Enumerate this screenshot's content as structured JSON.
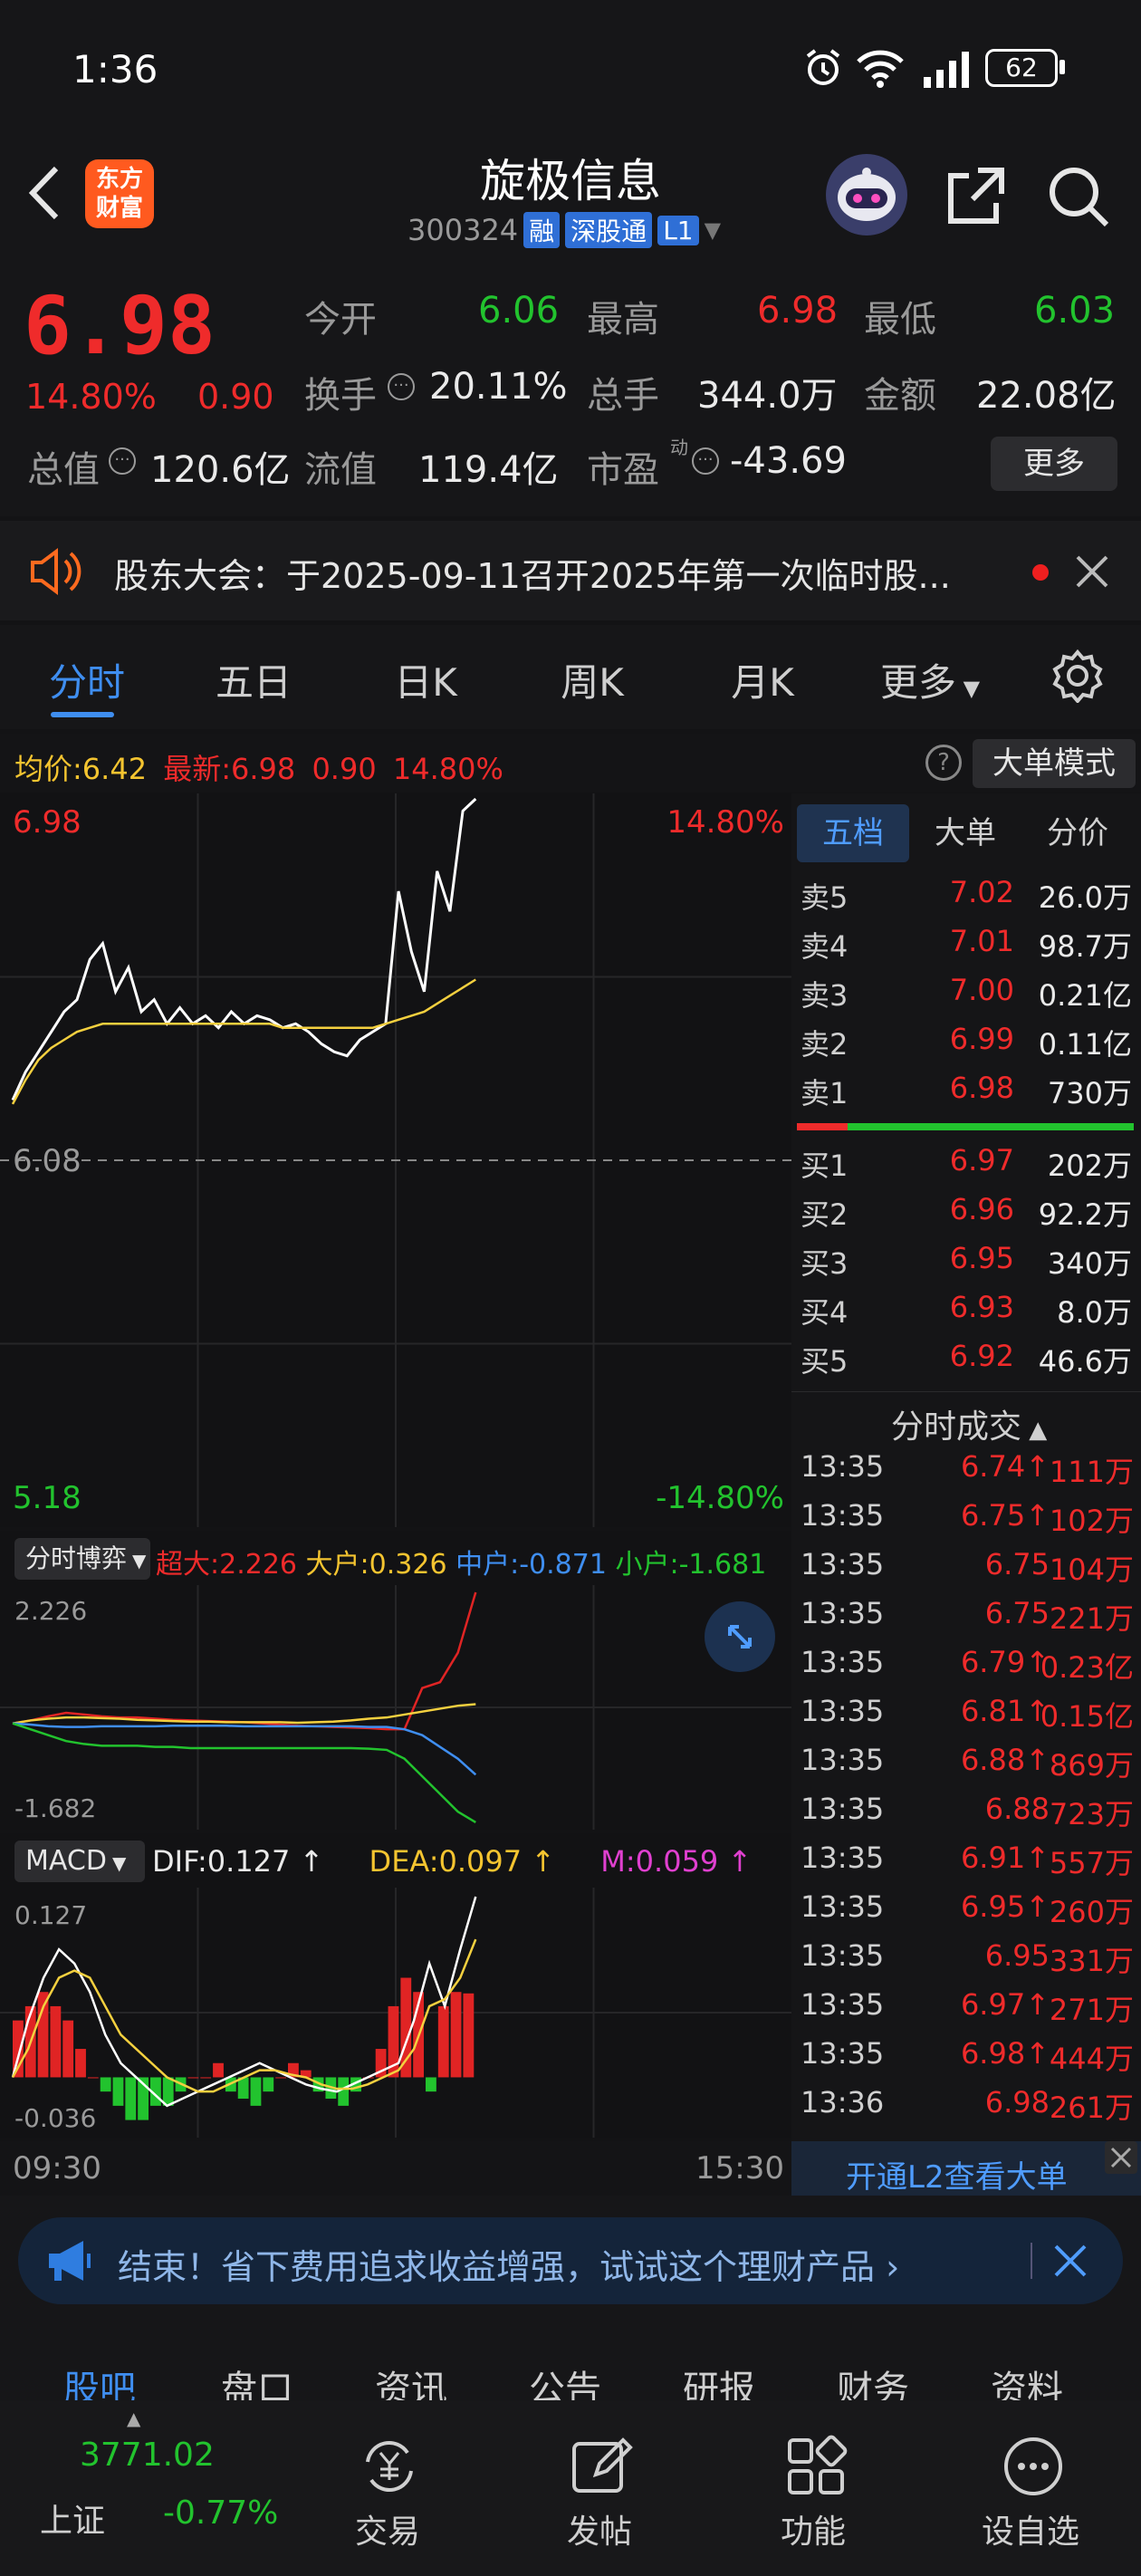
{
  "status": {
    "time": "1:36",
    "battery": "62"
  },
  "header": {
    "name": "旋极信息",
    "code": "300324",
    "tag_rong": "融",
    "tag_sgt": "深股通",
    "tag_l1": "L1",
    "logo_line1": "东方",
    "logo_line2": "财富"
  },
  "quote": {
    "price": "6.98",
    "pct": "14.80%",
    "chg": "0.90",
    "open_label": "今开",
    "open": "6.06",
    "high_label": "最高",
    "high": "6.98",
    "low_label": "最低",
    "low": "6.03",
    "turnover_label": "换手",
    "turnover": "20.11%",
    "vol_label": "总手",
    "vol": "344.0万",
    "amt_label": "金额",
    "amt": "22.08亿",
    "mcap_label": "总值",
    "mcap": "120.6亿",
    "fmcap_label": "流值",
    "fmcap": "119.4亿",
    "pe_label": "市盈",
    "pe_sup": "动",
    "pe": "-43.69",
    "more": "更多"
  },
  "notice": {
    "text": "股东大会：于2025-09-11召开2025年第一次临时股..."
  },
  "tabs": [
    "分时",
    "五日",
    "日K",
    "周K",
    "月K",
    "更多"
  ],
  "infobar": {
    "avg_label": "均价:",
    "avg": "6.42",
    "last_label": "最新:",
    "last": "6.98",
    "chg": "0.90",
    "pct": "14.80%",
    "mode": "大单模式"
  },
  "chart_data": [
    {
      "type": "line",
      "title": "分时",
      "x_range": [
        "09:30",
        "15:30"
      ],
      "y_top": "6.98",
      "y_base": "6.08",
      "y_bottom": "5.18",
      "pct_top": "14.80%",
      "pct_bottom": "-14.80%",
      "series": [
        {
          "name": "价格",
          "color": "#ffffff",
          "values": [
            6.23,
            6.3,
            6.35,
            6.4,
            6.45,
            6.48,
            6.58,
            6.62,
            6.5,
            6.56,
            6.45,
            6.48,
            6.42,
            6.46,
            6.42,
            6.44,
            6.41,
            6.45,
            6.42,
            6.44,
            6.43,
            6.41,
            6.42,
            6.4,
            6.37,
            6.35,
            6.34,
            6.38,
            6.4,
            6.42,
            6.75,
            6.6,
            6.5,
            6.8,
            6.7,
            6.95,
            6.98
          ]
        },
        {
          "name": "均价",
          "color": "#f4d03f",
          "values": [
            6.22,
            6.28,
            6.33,
            6.36,
            6.38,
            6.4,
            6.41,
            6.42,
            6.42,
            6.42,
            6.42,
            6.42,
            6.42,
            6.42,
            6.42,
            6.42,
            6.42,
            6.42,
            6.42,
            6.42,
            6.42,
            6.41,
            6.41,
            6.41,
            6.41,
            6.41,
            6.41,
            6.41,
            6.41,
            6.42,
            6.43,
            6.44,
            6.45,
            6.47,
            6.49,
            6.51,
            6.53
          ]
        }
      ]
    },
    {
      "type": "line",
      "title": "分时博弈",
      "labels": {
        "btn": "分时博弈",
        "super_label": "超大:",
        "super": "2.226",
        "big_label": "大户:",
        "big": "0.326",
        "mid_label": "中户:",
        "mid": "-0.871",
        "small_label": "小户:",
        "small": "-1.681"
      },
      "ylim": [
        "-1.682",
        "2.226"
      ],
      "series": [
        {
          "name": "超大",
          "color": "#e02424",
          "values": [
            0.0,
            0.05,
            0.12,
            0.18,
            0.15,
            0.12,
            0.1,
            0.1,
            0.08,
            0.06,
            0.05,
            0.04,
            0.03,
            0.02,
            0.0,
            -0.02,
            -0.04,
            -0.05,
            -0.06,
            -0.07,
            -0.08,
            -0.1,
            -0.1,
            0.6,
            0.7,
            1.2,
            2.226
          ]
        },
        {
          "name": "大户",
          "color": "#f4d03f",
          "values": [
            0.0,
            0.05,
            0.08,
            0.1,
            0.1,
            0.09,
            0.08,
            0.06,
            0.05,
            0.04,
            0.03,
            0.03,
            0.02,
            0.02,
            0.02,
            0.02,
            0.01,
            0.02,
            0.03,
            0.05,
            0.08,
            0.1,
            0.15,
            0.2,
            0.25,
            0.3,
            0.326
          ]
        },
        {
          "name": "中户",
          "color": "#3f8ef0",
          "values": [
            0.0,
            -0.02,
            -0.05,
            -0.06,
            -0.06,
            -0.05,
            -0.05,
            -0.05,
            -0.05,
            -0.04,
            -0.04,
            -0.04,
            -0.04,
            -0.05,
            -0.05,
            -0.05,
            -0.05,
            -0.05,
            -0.05,
            -0.05,
            -0.06,
            -0.06,
            -0.1,
            -0.2,
            -0.4,
            -0.6,
            -0.871
          ]
        },
        {
          "name": "小户",
          "color": "#22c32e",
          "values": [
            0.0,
            -0.1,
            -0.2,
            -0.3,
            -0.35,
            -0.38,
            -0.38,
            -0.38,
            -0.4,
            -0.4,
            -0.42,
            -0.42,
            -0.42,
            -0.42,
            -0.42,
            -0.42,
            -0.42,
            -0.42,
            -0.42,
            -0.42,
            -0.43,
            -0.45,
            -0.6,
            -0.9,
            -1.2,
            -1.5,
            -1.681
          ]
        }
      ]
    },
    {
      "type": "bar",
      "title": "MACD",
      "labels": {
        "btn": "MACD",
        "dif_label": "DIF:",
        "dif": "0.127",
        "dea_label": "DEA:",
        "dea": "0.097",
        "m_label": "M:",
        "m": "0.059"
      },
      "ylim": [
        "-0.036",
        "0.127"
      ],
      "series": [
        {
          "name": "M",
          "values": [
            0.04,
            0.05,
            0.06,
            0.05,
            0.04,
            0.02,
            0.0,
            -0.01,
            -0.02,
            -0.03,
            -0.03,
            -0.02,
            -0.02,
            -0.01,
            0.0,
            0.0,
            0.01,
            -0.01,
            -0.015,
            -0.02,
            -0.01,
            0.0,
            0.01,
            0.005,
            -0.01,
            -0.015,
            -0.02,
            -0.01,
            0.0,
            0.02,
            0.05,
            0.07,
            0.06,
            -0.01,
            0.05,
            0.06,
            0.059
          ]
        },
        {
          "name": "DIF",
          "color": "#ffffff",
          "values": [
            0.0,
            0.04,
            0.07,
            0.09,
            0.08,
            0.06,
            0.03,
            0.01,
            0.0,
            -0.01,
            -0.02,
            -0.015,
            -0.01,
            -0.005,
            0.0,
            0.005,
            0.01,
            0.005,
            0.0,
            -0.005,
            -0.008,
            -0.01,
            -0.005,
            0.0,
            0.005,
            0.01,
            0.04,
            0.08,
            0.05,
            0.09,
            0.127
          ]
        },
        {
          "name": "DEA",
          "color": "#f4d03f",
          "values": [
            0.0,
            0.02,
            0.05,
            0.07,
            0.075,
            0.07,
            0.05,
            0.03,
            0.02,
            0.01,
            0.0,
            -0.005,
            -0.01,
            -0.01,
            -0.005,
            0.0,
            0.005,
            0.005,
            0.002,
            0.0,
            -0.005,
            -0.008,
            -0.008,
            -0.005,
            0.0,
            0.005,
            0.02,
            0.05,
            0.055,
            0.07,
            0.097
          ]
        }
      ]
    }
  ],
  "orderbook": {
    "tabs": [
      "五档",
      "大单",
      "分价"
    ],
    "asks": [
      {
        "label": "卖5",
        "price": "7.02",
        "vol": "26.0万"
      },
      {
        "label": "卖4",
        "price": "7.01",
        "vol": "98.7万"
      },
      {
        "label": "卖3",
        "price": "7.00",
        "vol": "0.21亿"
      },
      {
        "label": "卖2",
        "price": "6.99",
        "vol": "0.11亿"
      },
      {
        "label": "卖1",
        "price": "6.98",
        "vol": "730万"
      }
    ],
    "bids": [
      {
        "label": "买1",
        "price": "6.97",
        "vol": "202万"
      },
      {
        "label": "买2",
        "price": "6.96",
        "vol": "92.2万"
      },
      {
        "label": "买3",
        "price": "6.95",
        "vol": "340万"
      },
      {
        "label": "买4",
        "price": "6.93",
        "vol": "8.0万"
      },
      {
        "label": "买5",
        "price": "6.92",
        "vol": "46.6万"
      }
    ]
  },
  "ticks": {
    "title": "分时成交",
    "rows": [
      {
        "t": "13:35",
        "p": "6.74",
        "up": "↑",
        "v": "111万"
      },
      {
        "t": "13:35",
        "p": "6.75",
        "up": "↑",
        "v": "102万"
      },
      {
        "t": "13:35",
        "p": "6.75",
        "up": "",
        "v": "104万"
      },
      {
        "t": "13:35",
        "p": "6.75",
        "up": "",
        "v": "221万"
      },
      {
        "t": "13:35",
        "p": "6.79",
        "up": "↑",
        "v": "0.23亿"
      },
      {
        "t": "13:35",
        "p": "6.81",
        "up": "↑",
        "v": "0.15亿"
      },
      {
        "t": "13:35",
        "p": "6.88",
        "up": "↑",
        "v": "869万"
      },
      {
        "t": "13:35",
        "p": "6.88",
        "up": "",
        "v": "723万"
      },
      {
        "t": "13:35",
        "p": "6.91",
        "up": "↑",
        "v": "557万"
      },
      {
        "t": "13:35",
        "p": "6.95",
        "up": "↑",
        "v": "260万"
      },
      {
        "t": "13:35",
        "p": "6.95",
        "up": "",
        "v": "331万"
      },
      {
        "t": "13:35",
        "p": "6.97",
        "up": "↑",
        "v": "271万"
      },
      {
        "t": "13:35",
        "p": "6.98",
        "up": "↑",
        "v": "444万"
      },
      {
        "t": "13:36",
        "p": "6.98",
        "up": "",
        "v": "261万"
      }
    ],
    "l2": "开通L2查看大单"
  },
  "ad": {
    "text": "结束！省下费用追求收益增强，试试这个理财产品"
  },
  "bottom_tabs": [
    "股吧",
    "盘口",
    "资讯",
    "公告",
    "研报",
    "财务",
    "资料"
  ],
  "bottom_bar": {
    "index_val": "3771.02",
    "index_name": "上证",
    "index_pct": "-0.77%",
    "trade": "交易",
    "post": "发帖",
    "func": "功能",
    "custom": "设自选"
  }
}
